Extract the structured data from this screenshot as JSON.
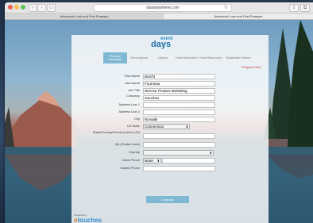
{
  "browser": {
    "url": "dawanywhere.com",
    "tabs": [
      "Advanced Look and Feel Example",
      "Advanced Look and Feel Example"
    ],
    "traffic_light_colors": [
      "#ed5f57",
      "#f5bd4f",
      "#5fc454"
    ]
  },
  "logo": {
    "top": "event",
    "main": "days"
  },
  "steps": [
    "Personal Information",
    "Select Agenda",
    "Options",
    "Hotel Reservation",
    "Travel Reservation",
    "Registration Review"
  ],
  "active_step": 0,
  "required_note": "* Required Field",
  "form": {
    "first_name": {
      "label": "First Name",
      "value": "Brecht"
    },
    "last_name": {
      "label": "Last Name",
      "value": "Fourneau"
    },
    "job_title": {
      "label": "Job Title",
      "value": "Director Product Marketing"
    },
    "company": {
      "label": "Company",
      "value": "etouches"
    },
    "address1": {
      "label": "Address Line 1",
      "value": ""
    },
    "address2": {
      "label": "Address Line 2",
      "value": ""
    },
    "city": {
      "label": "City",
      "value": "Norwalk"
    },
    "state": {
      "label": "US State",
      "value": "Connecticut"
    },
    "province": {
      "label": "State/Country/Province (Non-US)",
      "value": ""
    },
    "zip": {
      "label": "Zip (Postal Code)",
      "value": ""
    },
    "country": {
      "label": "Country",
      "value": ""
    },
    "work_phone": {
      "label": "Work Phone",
      "value": "None"
    },
    "mobile_phone": {
      "label": "Mobile Phone",
      "value": ""
    }
  },
  "continue_label": "Continue",
  "footer": {
    "powered_by": "Powered by",
    "brand_e": "e",
    "brand_rest": "touches"
  }
}
